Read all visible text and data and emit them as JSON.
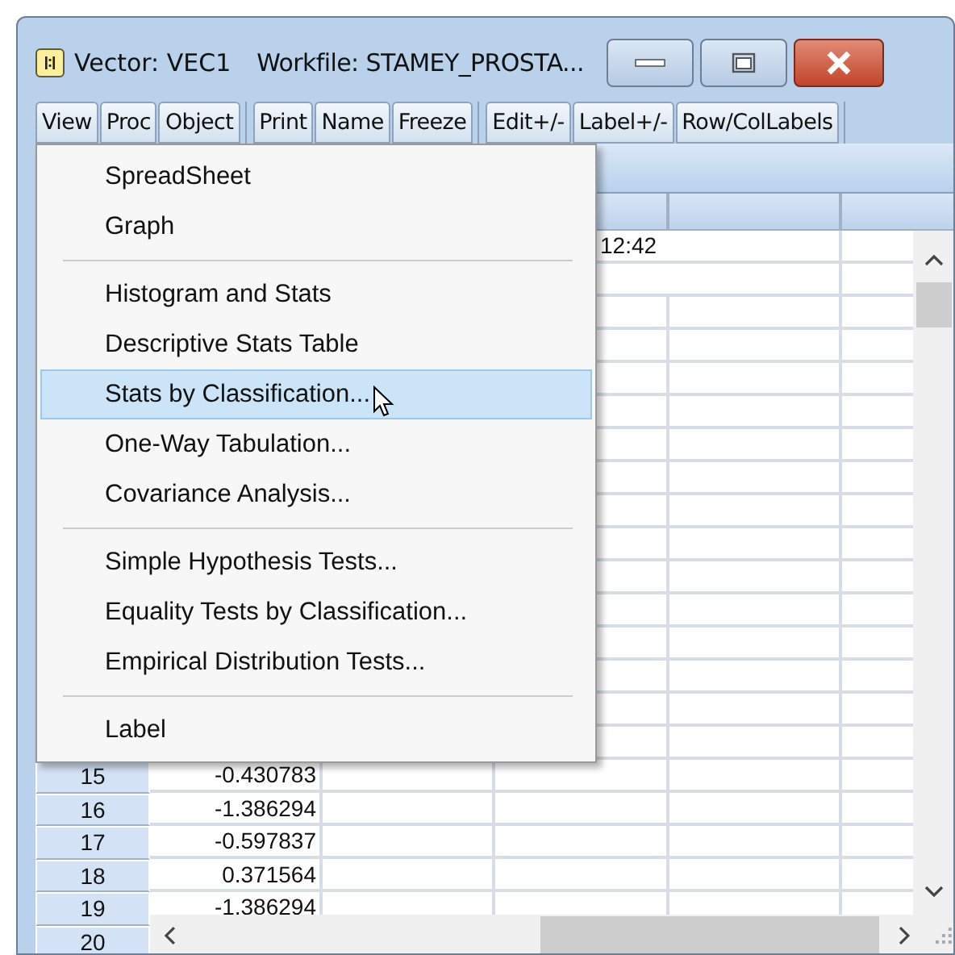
{
  "window": {
    "title": "Vector: VEC1",
    "workfile": "Workfile: STAMEY_PROSTA..."
  },
  "toolbar": [
    [
      "View",
      "Proc",
      "Object"
    ],
    [
      "Print",
      "Name",
      "Freeze"
    ],
    [
      "Edit+/-",
      "Label+/-",
      "Row/ColLabels"
    ]
  ],
  "grid": {
    "timestamp": "12:42",
    "rows": [
      {
        "label": "15",
        "value": "-0.430783"
      },
      {
        "label": "16",
        "value": "-1.386294"
      },
      {
        "label": "17",
        "value": "-0.597837"
      },
      {
        "label": "18",
        "value": "0.371564"
      },
      {
        "label": "19",
        "value": "-1.386294"
      },
      {
        "label": "20"
      }
    ]
  },
  "menu": [
    {
      "kind": "item",
      "label": "SpreadSheet",
      "selected": false
    },
    {
      "kind": "item",
      "label": "Graph",
      "selected": false
    },
    {
      "kind": "separator"
    },
    {
      "kind": "item",
      "label": "Histogram and Stats",
      "selected": false
    },
    {
      "kind": "item",
      "label": "Descriptive Stats Table",
      "selected": false
    },
    {
      "kind": "item",
      "label": "Stats by Classification...",
      "selected": true
    },
    {
      "kind": "item",
      "label": "One-Way Tabulation...",
      "selected": false
    },
    {
      "kind": "item",
      "label": "Covariance Analysis...",
      "selected": false
    },
    {
      "kind": "separator"
    },
    {
      "kind": "item",
      "label": "Simple Hypothesis Tests...",
      "selected": false
    },
    {
      "kind": "item",
      "label": "Equality Tests by Classification...",
      "selected": false
    },
    {
      "kind": "item",
      "label": "Empirical Distribution Tests...",
      "selected": false
    },
    {
      "kind": "separator"
    },
    {
      "kind": "item",
      "label": "Label",
      "selected": false
    }
  ]
}
